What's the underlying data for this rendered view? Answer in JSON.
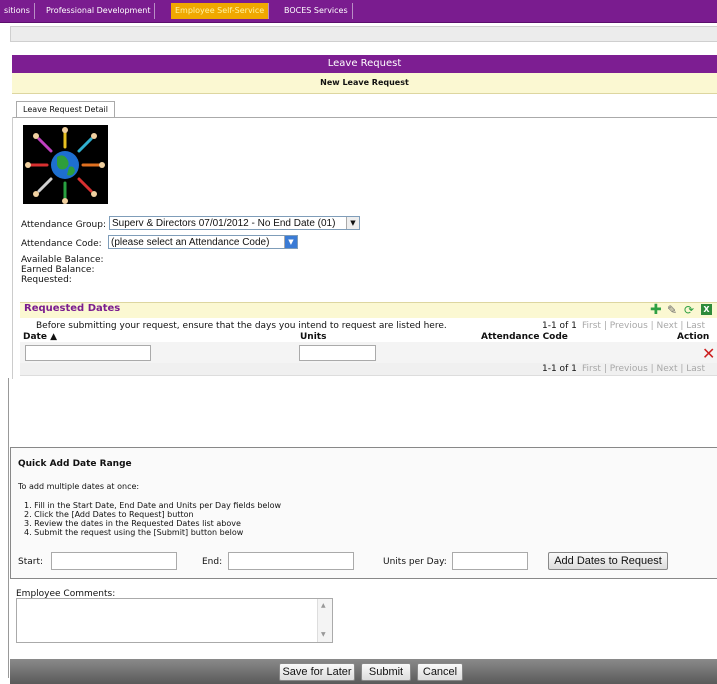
{
  "nav": {
    "tabs": [
      "sitions",
      "Professional Development",
      "Employee Self-Service",
      "BOCES Services"
    ],
    "active": "Employee Self-Service"
  },
  "page": {
    "title": "Leave Request",
    "subtitle": "New Leave Request",
    "detail_tab": "Leave Request Detail"
  },
  "form": {
    "attendance_group_label": "Attendance Group:",
    "attendance_group_value": "Superv & Directors 07/01/2012 - No End Date (01)",
    "attendance_code_label": "Attendance Code:",
    "attendance_code_value": "(please select an Attendance Code)",
    "available_balance_label": "Available Balance:",
    "earned_balance_label": "Earned Balance:",
    "requested_label": "Requested:"
  },
  "requested_dates": {
    "title": "Requested Dates",
    "instruction": "Before submitting your request, ensure that the days you intend to request are listed here.",
    "count": "1-1 of 1",
    "pager": [
      "First",
      "Previous",
      "Next",
      "Last"
    ],
    "columns": [
      "Date ▲",
      "Units",
      "Attendance Code",
      "Action"
    ],
    "icons": [
      "add-icon",
      "edit-icon",
      "refresh-icon",
      "excel-icon"
    ]
  },
  "quick_add": {
    "title": "Quick Add Date Range",
    "intro": "To add multiple dates at once:",
    "steps": [
      "1.  Fill in the Start Date, End Date and Units per Day fields below",
      "2.  Click the [Add Dates to Request] button",
      "3.  Review the dates in the Requested Dates list above",
      "4.  Submit the request using the [Submit] button below"
    ],
    "start_label": "Start:",
    "end_label": "End:",
    "units_label": "Units per Day:",
    "add_button": "Add Dates to Request"
  },
  "comments": {
    "label": "Employee Comments:"
  },
  "actions": {
    "save_later": "Save for Later",
    "submit": "Submit",
    "cancel": "Cancel"
  },
  "colors": {
    "nav_purple": "#7a1c8f",
    "active_tab": "#f0a800",
    "title_bar": "#7d1e92",
    "subtitle_bg": "#fbf8d2",
    "delete_red": "#cc1f1f"
  }
}
